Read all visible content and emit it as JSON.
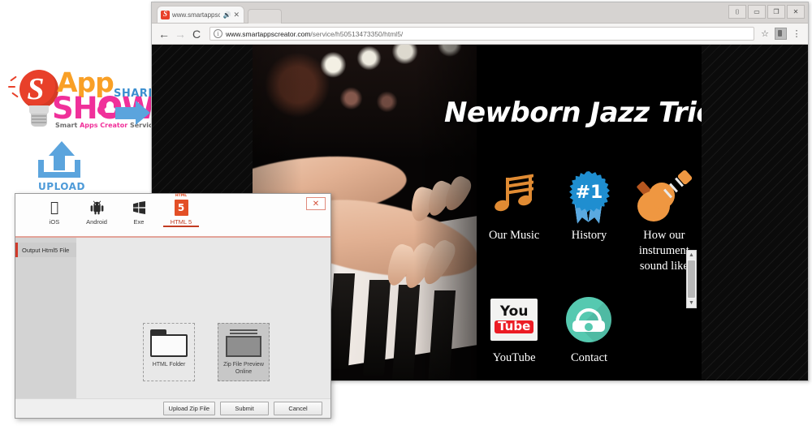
{
  "logo": {
    "bulb_letter": "S",
    "word_app": "App",
    "word_show": "SHOW",
    "tagline_part1": "Smart ",
    "tagline_highlight": "Apps Creator ",
    "tagline_part2": "Service",
    "upload_label": "UPLOAD",
    "share_label": "SHARE",
    "accent_orange": "#f9a026",
    "accent_pink": "#f0309a",
    "accent_blue": "#5ba4dd",
    "accent_red": "#e8402a"
  },
  "browser": {
    "tab": {
      "title": "www.smartappscreat...",
      "audio_icon": "speaker-icon",
      "close_icon": "✕"
    },
    "new_tab_icon": "new-tab",
    "window_controls": [
      {
        "name": "minimize",
        "glyph": "⌷"
      },
      {
        "name": "restore",
        "glyph": "▭"
      },
      {
        "name": "maximize",
        "glyph": "❐"
      },
      {
        "name": "close",
        "glyph": "✕"
      }
    ],
    "toolbar": {
      "back_icon": "←",
      "forward_icon": "→",
      "reload_icon": "⟳",
      "info_icon": "i",
      "url_domain": "www.smartappscreator.com",
      "url_path": "/service/h50513473350/html5/",
      "bookmark_icon": "☆",
      "extension_icon": "extension-icon",
      "menu_icon": "⋮"
    }
  },
  "app": {
    "title": "Newborn Jazz Trio",
    "icons": [
      {
        "label": "Our Music",
        "icon": "music-note-icon"
      },
      {
        "label": "History",
        "icon": "ribbon-badge-icon",
        "badge_text": "#1"
      },
      {
        "label": "How our instrument sound like",
        "icon": "guitar-icon"
      },
      {
        "label": "YouTube",
        "icon": "youtube-icon",
        "yt_you": "You",
        "yt_tube": "Tube"
      },
      {
        "label": "Contact",
        "icon": "telephone-icon"
      }
    ],
    "scrollbar": {
      "up_arrow": "▲",
      "down_arrow": "▼"
    }
  },
  "dialog": {
    "close_label": "✕",
    "platform_tabs": [
      {
        "label": "iOS",
        "icon": "apple-icon",
        "glyph": "",
        "active": false
      },
      {
        "label": "Android",
        "icon": "android-icon",
        "glyph": "🤖",
        "active": false
      },
      {
        "label": "Exe",
        "icon": "windows-icon",
        "glyph": "⊞",
        "active": false
      },
      {
        "label": "HTML 5",
        "icon": "html5-icon",
        "glyph": "5",
        "mini": "HTML",
        "active": true
      }
    ],
    "sidebar_items": [
      {
        "label": "Output Html5 File"
      }
    ],
    "file_options": [
      {
        "label": "HTML Folder",
        "icon": "folder-icon",
        "selected": false
      },
      {
        "label": "Zip File Preview Online",
        "icon": "zip-archive-icon",
        "selected": true
      }
    ],
    "buttons": [
      {
        "label": "Upload Zip File",
        "name": "upload-zip-file-button"
      },
      {
        "label": "Submit",
        "name": "submit-button"
      },
      {
        "label": "Cancel",
        "name": "cancel-button"
      }
    ]
  }
}
